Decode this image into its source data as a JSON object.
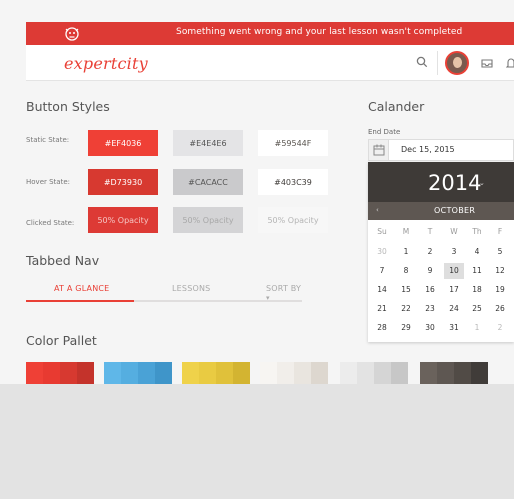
{
  "error_banner": {
    "text": "Something went wrong and your last lesson wasn't completed",
    "color": "#dd3a35"
  },
  "topbar": {
    "logo": "expertcity",
    "logo_color": "#e94036"
  },
  "button_styles": {
    "title": "Button Styles",
    "rows": [
      {
        "label": "Static State:",
        "swatches": [
          {
            "text": "#EF4036",
            "bg": "#ef4036",
            "fg": "#ffffff"
          },
          {
            "text": "#E4E4E6",
            "bg": "#e4e4e6",
            "fg": "#555555"
          },
          {
            "text": "#59544F",
            "bg": "#ffffff",
            "fg": "#59544f"
          }
        ]
      },
      {
        "label": "Hover State:",
        "swatches": [
          {
            "text": "#D73930",
            "bg": "#d73930",
            "fg": "#ffffff"
          },
          {
            "text": "#CACACC",
            "bg": "#cacacc",
            "fg": "#555555"
          },
          {
            "text": "#403C39",
            "bg": "#ffffff",
            "fg": "#403c39"
          }
        ]
      },
      {
        "label": "Clicked State:",
        "swatches": [
          {
            "text": "50% Opacity",
            "bg": "#dd3a35",
            "fg": "#f5c4c2"
          },
          {
            "text": "50% Opacity",
            "bg": "#d4d4d6",
            "fg": "#a8a8a8"
          },
          {
            "text": "50% Opacity",
            "bg": "#f7f7f7",
            "fg": "#b5b5b5"
          }
        ]
      }
    ]
  },
  "tabbed_nav": {
    "title": "Tabbed Nav",
    "tabs": [
      {
        "label": "AT A GLANCE",
        "active": true
      },
      {
        "label": "LESSONS",
        "active": false
      },
      {
        "label": "SORT BY",
        "active": false
      }
    ]
  },
  "color_pallet": {
    "title": "Color Pallet",
    "groups": [
      [
        "#ef4036",
        "#e83a31",
        "#d73930",
        "#c4332b"
      ],
      [
        "#5fb7e8",
        "#55aee0",
        "#4aa2d6",
        "#3f95c9"
      ],
      [
        "#efd24a",
        "#e9cb42",
        "#e0c13a",
        "#d3b431"
      ],
      [
        "#f7f5f2",
        "#f1eeea",
        "#e9e5df",
        "#ddd7cf"
      ],
      [
        "#ececec",
        "#e3e3e3",
        "#d5d5d5",
        "#c7c7c7"
      ],
      [
        "#6a625c",
        "#5e5752",
        "#514b46",
        "#403c39"
      ]
    ]
  },
  "calendar": {
    "title": "Calander",
    "field_label": "End Date",
    "field_value": "Dec 15, 2015",
    "year": "2014",
    "month": "OCTOBER",
    "weekdays": [
      "Su",
      "M",
      "T",
      "W",
      "Th",
      "F"
    ],
    "weeks": [
      [
        {
          "d": "30",
          "muted": true
        },
        {
          "d": "1"
        },
        {
          "d": "2"
        },
        {
          "d": "3"
        },
        {
          "d": "4"
        },
        {
          "d": "5"
        }
      ],
      [
        {
          "d": "7"
        },
        {
          "d": "8"
        },
        {
          "d": "9"
        },
        {
          "d": "10",
          "selected": true
        },
        {
          "d": "11"
        },
        {
          "d": "12"
        }
      ],
      [
        {
          "d": "14"
        },
        {
          "d": "15"
        },
        {
          "d": "16"
        },
        {
          "d": "17"
        },
        {
          "d": "18"
        },
        {
          "d": "19"
        }
      ],
      [
        {
          "d": "21"
        },
        {
          "d": "22"
        },
        {
          "d": "23"
        },
        {
          "d": "24"
        },
        {
          "d": "25"
        },
        {
          "d": "26"
        }
      ],
      [
        {
          "d": "28"
        },
        {
          "d": "29"
        },
        {
          "d": "30"
        },
        {
          "d": "31"
        },
        {
          "d": "1",
          "muted": true
        },
        {
          "d": "2",
          "muted": true
        }
      ]
    ]
  }
}
